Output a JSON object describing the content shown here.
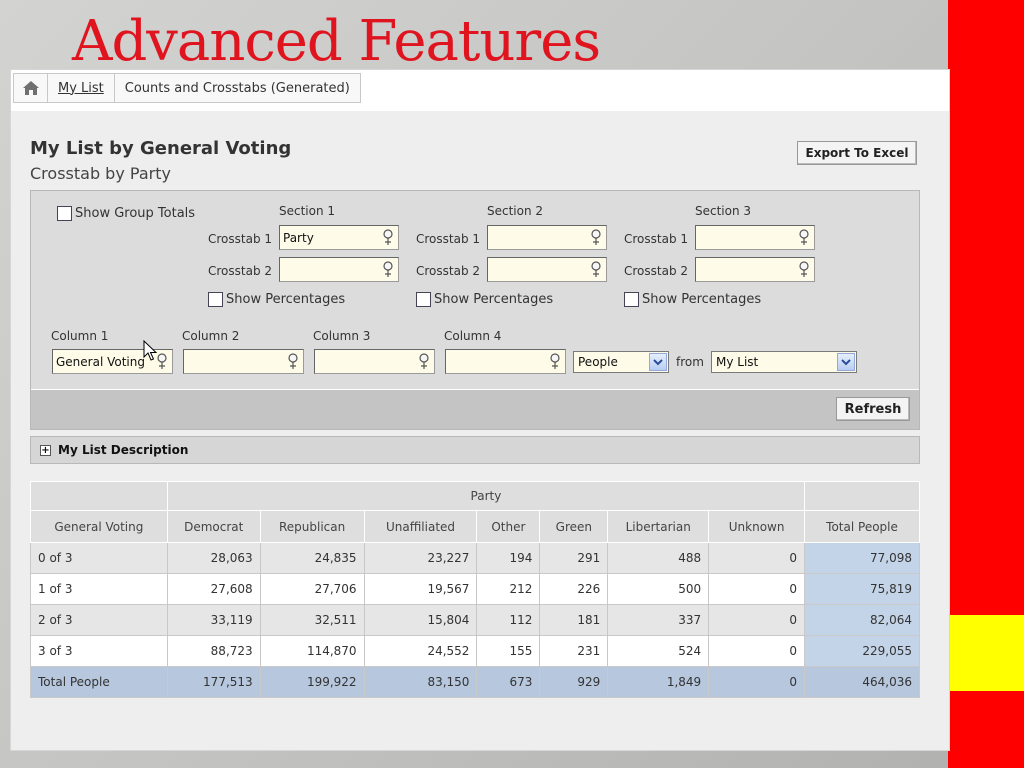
{
  "slide": {
    "title": "Advanced Features"
  },
  "breadcrumb": {
    "link": "My List",
    "current": "Counts and Crosstabs (Generated)"
  },
  "report": {
    "title": "My List by General Voting",
    "subtitle": "Crosstab by Party",
    "export_label": "Export To Excel"
  },
  "options": {
    "show_group_totals": "Show Group Totals",
    "sections": [
      {
        "heading": "Section 1",
        "crosstab1_label": "Crosstab 1",
        "crosstab1_value": "Party",
        "crosstab2_label": "Crosstab 2",
        "crosstab2_value": "",
        "show_percentages": "Show Percentages"
      },
      {
        "heading": "Section 2",
        "crosstab1_label": "Crosstab 1",
        "crosstab1_value": "",
        "crosstab2_label": "Crosstab 2",
        "crosstab2_value": "",
        "show_percentages": "Show Percentages"
      },
      {
        "heading": "Section 3",
        "crosstab1_label": "Crosstab 1",
        "crosstab1_value": "",
        "crosstab2_label": "Crosstab 2",
        "crosstab2_value": "",
        "show_percentages": "Show Percentages"
      }
    ],
    "columns": [
      {
        "label": "Column 1",
        "value": "General Voting"
      },
      {
        "label": "Column 2",
        "value": ""
      },
      {
        "label": "Column 3",
        "value": ""
      },
      {
        "label": "Column 4",
        "value": ""
      }
    ],
    "entity_select": "People",
    "from_label": "from",
    "source_select": "My List",
    "refresh_label": "Refresh"
  },
  "description": {
    "label": "My List Description"
  },
  "table": {
    "group_header": "Party",
    "row_header": "General Voting",
    "columns": [
      "Democrat",
      "Republican",
      "Unaffiliated",
      "Other",
      "Green",
      "Libertarian",
      "Unknown"
    ],
    "total_header": "Total People",
    "rows": [
      {
        "label": "0 of 3",
        "values": [
          "28,063",
          "24,835",
          "23,227",
          "194",
          "291",
          "488",
          "0"
        ],
        "total": "77,098"
      },
      {
        "label": "1 of 3",
        "values": [
          "27,608",
          "27,706",
          "19,567",
          "212",
          "226",
          "500",
          "0"
        ],
        "total": "75,819"
      },
      {
        "label": "2 of 3",
        "values": [
          "33,119",
          "32,511",
          "15,804",
          "112",
          "181",
          "337",
          "0"
        ],
        "total": "82,064"
      },
      {
        "label": "3 of 3",
        "values": [
          "88,723",
          "114,870",
          "24,552",
          "155",
          "231",
          "524",
          "0"
        ],
        "total": "229,055"
      }
    ],
    "totals_row": {
      "label": "Total People",
      "values": [
        "177,513",
        "199,922",
        "83,150",
        "673",
        "929",
        "1,849",
        "0"
      ],
      "total": "464,036"
    }
  },
  "colors": {
    "title_red": "#e0141e",
    "sidebar_red": "#ff0000",
    "sidebar_yellow": "#ffff00",
    "total_blue": "#c4d4e8"
  },
  "icons": {
    "home": "home-icon",
    "pin": "map-pin-icon",
    "dropdown": "chevron-down-icon",
    "expand": "plus-box-icon",
    "cursor": "mouse-pointer-icon"
  }
}
